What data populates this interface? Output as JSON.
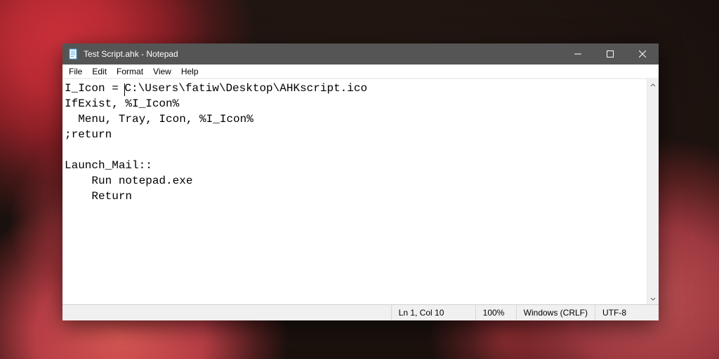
{
  "window": {
    "title": "Test Script.ahk - Notepad"
  },
  "menu": {
    "file": "File",
    "edit": "Edit",
    "format": "Format",
    "view": "View",
    "help": "Help"
  },
  "editor": {
    "pre_caret": "I_Icon = ",
    "post_caret": "C:\\Users\\fatiw\\Desktop\\AHKscript.ico\nIfExist, %I_Icon%\n  Menu, Tray, Icon, %I_Icon%\n;return\n\nLaunch_Mail::\n    Run notepad.exe\n    Return"
  },
  "status": {
    "position": "Ln 1, Col 10",
    "zoom": "100%",
    "line_ending": "Windows (CRLF)",
    "encoding": "UTF-8"
  }
}
